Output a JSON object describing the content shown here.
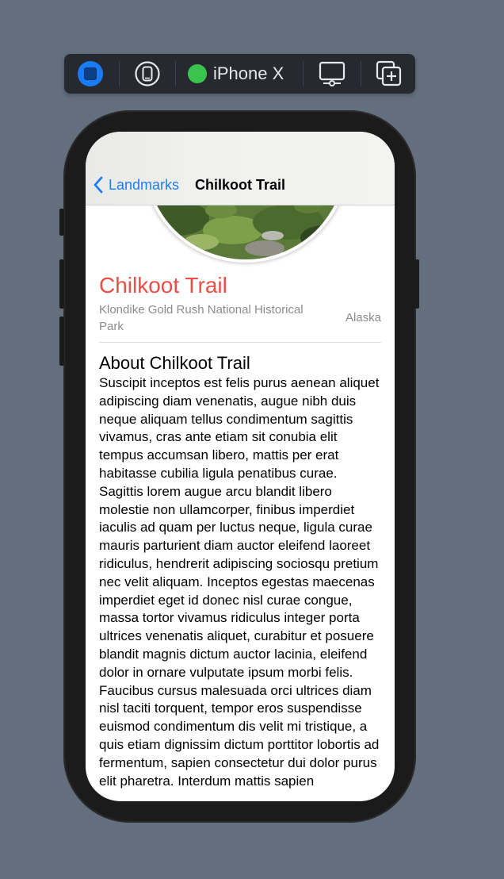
{
  "toolbar": {
    "live_icon": "live-preview-icon",
    "device_icon": "device-icon",
    "device_name": "iPhone X",
    "device_status_color": "#3bc44d",
    "settings_icon": "device-settings-icon",
    "duplicate_icon": "duplicate-preview-icon"
  },
  "nav": {
    "back_label": "Landmarks",
    "title": "Chilkoot Trail"
  },
  "landmark": {
    "name": "Chilkoot Trail",
    "park": "Klondike Gold Rush National Historical Park",
    "state": "Alaska",
    "about_heading": "About Chilkoot Trail",
    "description": "Suscipit inceptos est felis purus aenean aliquet adipiscing diam venenatis, augue nibh duis neque aliquam tellus condimentum sagittis vivamus, cras ante etiam sit conubia elit tempus accumsan libero, mattis per erat habitasse cubilia ligula penatibus curae. Sagittis lorem augue arcu blandit libero molestie non ullamcorper, finibus imperdiet iaculis ad quam per luctus neque, ligula curae mauris parturient diam auctor eleifend laoreet ridiculus, hendrerit adipiscing sociosqu pretium nec velit aliquam. Inceptos egestas maecenas imperdiet eget id donec nisl curae congue, massa tortor vivamus ridiculus integer porta ultrices venenatis aliquet, curabitur et posuere blandit magnis dictum auctor lacinia, eleifend dolor in ornare vulputate ipsum morbi felis. Faucibus cursus malesuada orci ultrices diam nisl taciti torquent, tempor eros suspendisse euismod condimentum dis velit mi tristique, a quis etiam dignissim dictum porttitor lobortis ad fermentum, sapien consectetur dui dolor purus elit pharetra. Interdum mattis sapien"
  },
  "colors": {
    "accent": "#1d7df6",
    "title": "#ea4e48",
    "background": "#646f7e"
  }
}
